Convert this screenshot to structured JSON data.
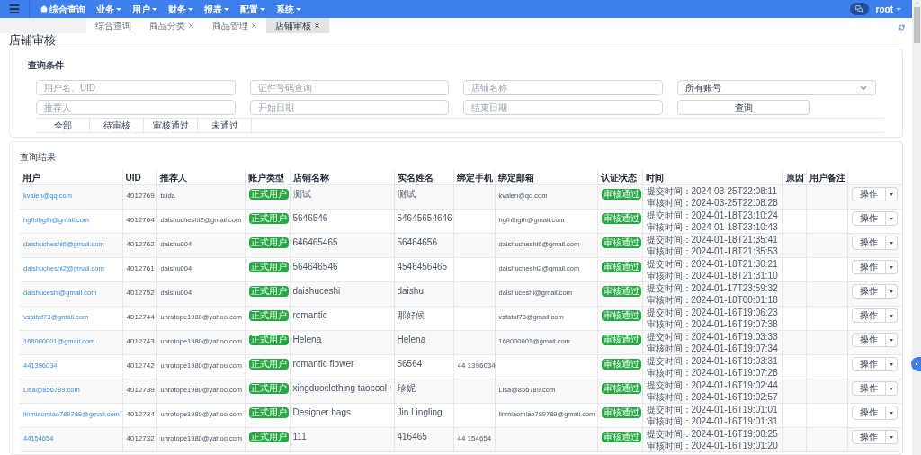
{
  "navbar": {
    "home": "综合查询",
    "menus": [
      "业务",
      "用户",
      "财务",
      "报表",
      "配置",
      "系统"
    ],
    "user": "root"
  },
  "tabs": [
    {
      "label": "综合查询",
      "closable": false,
      "selected": false
    },
    {
      "label": "商品分类",
      "closable": true,
      "selected": false
    },
    {
      "label": "商品管理",
      "closable": true,
      "selected": false
    },
    {
      "label": "店铺审核",
      "closable": true,
      "selected": true
    }
  ],
  "page_title": "店铺审核",
  "filters": {
    "title": "查询条件",
    "fields": [
      {
        "kind": "input",
        "placeholder": "用户名、UID"
      },
      {
        "kind": "input",
        "placeholder": "证件号码查询"
      },
      {
        "kind": "input",
        "placeholder": "店铺名称"
      },
      {
        "kind": "select",
        "value": "所有账号"
      },
      {
        "kind": "input",
        "placeholder": "推荐人"
      },
      {
        "kind": "input",
        "placeholder": "开始日期"
      },
      {
        "kind": "input",
        "placeholder": "结束日期"
      },
      {
        "kind": "button",
        "label": "查询"
      }
    ],
    "status_tabs": [
      {
        "label": "全部",
        "selected": false
      },
      {
        "label": "待审核",
        "selected": false
      },
      {
        "label": "审核通过",
        "selected": false
      },
      {
        "label": "未通过",
        "selected": false
      }
    ]
  },
  "results": {
    "title": "查询结果",
    "columns": [
      "用户",
      "UID",
      "推荐人",
      "账户类型",
      "店铺名称",
      "实名姓名",
      "绑定手机",
      "绑定邮箱",
      "认证状态",
      "时间",
      "原因",
      "用户备注"
    ],
    "rows": [
      {
        "user": "kvalen@qq.com",
        "uid": "4012769",
        "referrer": "taida",
        "account_type": "正式用户",
        "shop_name": "测试",
        "real_name": "测试",
        "email": "kvalen@qq.com",
        "status": "审核通过",
        "submit_time": "提交时间：2024-03-25T22:08:11",
        "review_time": "审核时间：2024-03-25T22:08:28",
        "action": "操作"
      },
      {
        "user": "hgfhfhgfh@gmail.com",
        "uid": "4012764",
        "referrer": "daishucheshi2@gmail.com",
        "account_type": "正式用户",
        "shop_name": "5646546",
        "real_name": "54645654646",
        "email": "hgfhfhgfh@gmail.com",
        "status": "审核通过",
        "submit_time": "提交时间：2024-01-18T23:10:24",
        "review_time": "审核时间：2024-01-18T23:10:43",
        "action": "操作"
      },
      {
        "user": "daishucheshi6@gmail.com",
        "uid": "4012762",
        "referrer": "daishu004",
        "account_type": "正式用户",
        "shop_name": "646465465",
        "real_name": "56464656",
        "email": "daishucheshi6@gmail.com",
        "status": "审核通过",
        "submit_time": "提交时间：2024-01-18T21:35:41",
        "review_time": "审核时间：2024-01-18T21:35:53",
        "action": "操作"
      },
      {
        "user": "daishucheshi2@gmail.com",
        "uid": "4012761",
        "referrer": "daishu004",
        "account_type": "正式用户",
        "shop_name": "564646546",
        "real_name": "4546456465",
        "email": "daishucheshi2@gmail.com",
        "status": "审核通过",
        "submit_time": "提交时间：2024-01-18T21:30:21",
        "review_time": "审核时间：2024-01-18T21:31:10",
        "action": "操作"
      },
      {
        "user": "daishuceshi@gmail.com",
        "uid": "4012752",
        "referrer": "daishu004",
        "account_type": "正式用户",
        "shop_name": "daishuceshi",
        "real_name": "daishu",
        "email": "daishuceshi@gmail.com",
        "status": "审核通过",
        "submit_time": "提交时间：2024-01-17T23:59:32",
        "review_time": "审核时间：2024-01-18T00:01:18",
        "action": "操作"
      },
      {
        "user": "vsfafaf73@gmail.com",
        "uid": "4012744",
        "referrer": "unrotope1980@yahoo.com",
        "account_type": "正式用户",
        "shop_name": "romantic",
        "real_name": "那好候",
        "email": "vsfafaf73@gmail.com",
        "status": "审核通过",
        "submit_time": "提交时间：2024-01-16T19:06:23",
        "review_time": "审核时间：2024-01-16T19:07:38",
        "action": "操作"
      },
      {
        "user": "168000001@gmail.com",
        "uid": "4012743",
        "referrer": "unrotope1980@yahoo.com",
        "account_type": "正式用户",
        "shop_name": "Helena",
        "real_name": "Helena",
        "email": "168000001@gmail.com",
        "status": "审核通过",
        "submit_time": "提交时间：2024-01-16T19:03:33",
        "review_time": "审核时间：2024-01-16T19:07:34",
        "action": "操作"
      },
      {
        "user": "441396034",
        "uid": "4012742",
        "referrer": "unrotope1980@yahoo.com",
        "account_type": "正式用户",
        "shop_name": "romantic flower",
        "real_name": "56564",
        "phone": "44 1396034",
        "status": "审核通过",
        "submit_time": "提交时间：2024-01-16T19:03:31",
        "review_time": "审核时间：2024-01-16T19:07:28",
        "action": "操作"
      },
      {
        "user": "Lisa@856789.com",
        "uid": "4012739",
        "referrer": "unrotope1980@yahoo.com",
        "account_type": "正式用户",
        "shop_name": "xingduoclothing taocool ·",
        "real_name": "珍妮",
        "email": "Lisa@856789.com",
        "status": "审核通过",
        "submit_time": "提交时间：2024-01-16T19:02:44",
        "review_time": "审核时间：2024-01-16T19:02:57",
        "action": "操作"
      },
      {
        "user": "linmiaomiao789789@gmail.com",
        "uid": "4012734",
        "referrer": "unrotope1980@yahoo.com",
        "account_type": "正式用户",
        "shop_name": "Designer bags",
        "real_name": "Jin Lingling",
        "email": "linmiaomiao789789@gmail.com",
        "status": "审核通过",
        "submit_time": "提交时间：2024-01-16T19:01:01",
        "review_time": "审核时间：2024-01-16T19:01:31",
        "action": "操作"
      },
      {
        "user": "44154654",
        "uid": "4012732",
        "referrer": "unrotope1980@yahoo.com",
        "account_type": "正式用户",
        "shop_name": "111",
        "real_name": "416465",
        "phone": "44 154654",
        "status": "审核通过",
        "submit_time": "提交时间：2024-01-16T19:00:25",
        "review_time": "审核时间：2024-01-16T19:01:20",
        "action": "操作"
      }
    ]
  }
}
